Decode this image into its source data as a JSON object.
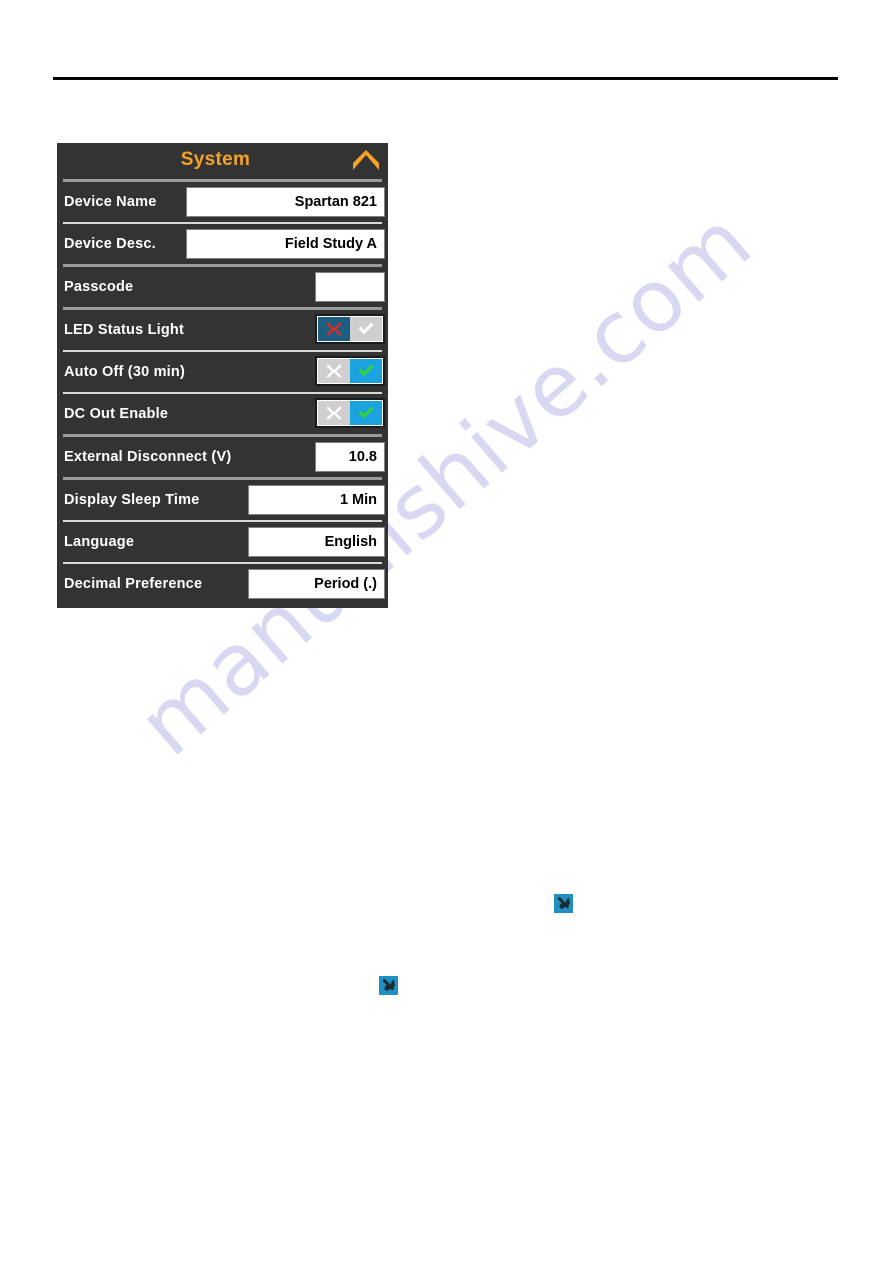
{
  "page": {
    "watermark_text": "manualshive.com",
    "watermark_color": "#d8d8f2",
    "background_color": "#ffffff",
    "rule_color": "#000000"
  },
  "panel": {
    "title": "System",
    "title_color": "#f5a22a",
    "background_color": "#333333",
    "collapse_icon": "chevron-up-icon",
    "rows": [
      {
        "label": "Device Name",
        "type": "text",
        "value": "Spartan 821",
        "field_width": "w-wide"
      },
      {
        "label": "Device Desc.",
        "type": "text",
        "value": "Field Study A",
        "field_width": "w-wide"
      },
      {
        "label": "Passcode",
        "type": "text",
        "value": "",
        "field_width": "w-empty"
      },
      {
        "label": "LED Status Light",
        "type": "toggle",
        "state": "off",
        "off_label": "X",
        "on_label": "check"
      },
      {
        "label": "Auto Off (30 min)",
        "type": "toggle",
        "state": "on",
        "off_label": "X",
        "on_label": "check"
      },
      {
        "label": "DC Out Enable",
        "type": "toggle",
        "state": "on",
        "off_label": "X",
        "on_label": "check"
      },
      {
        "label": "External Disconnect (V)",
        "type": "text",
        "value": "10.8",
        "field_width": "w-narrow"
      },
      {
        "label": "Display Sleep Time",
        "type": "text",
        "value": "1 Min",
        "field_width": "w-mid"
      },
      {
        "label": "Language",
        "type": "text",
        "value": "English",
        "field_width": "w-mid"
      },
      {
        "label": "Decimal Preference",
        "type": "text",
        "value": "Period (.)",
        "field_width": "w-mid"
      }
    ]
  },
  "inline_icons": [
    {
      "name": "tools-icon",
      "color": "#1f8fc4"
    },
    {
      "name": "tools-icon",
      "color": "#1f8fc4"
    }
  ]
}
